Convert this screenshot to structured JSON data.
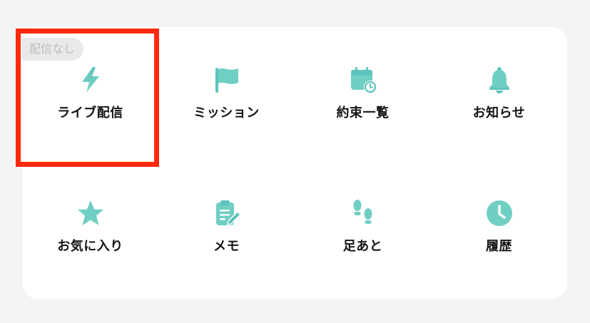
{
  "accent_color": "#6fcfc3",
  "badge": {
    "text": "配信なし"
  },
  "menu": {
    "items": [
      {
        "label": "ライブ配信",
        "icon": "lightning-icon"
      },
      {
        "label": "ミッション",
        "icon": "flag-icon"
      },
      {
        "label": "約束一覧",
        "icon": "calendar-clock-icon"
      },
      {
        "label": "お知らせ",
        "icon": "bell-icon"
      },
      {
        "label": "お気に入り",
        "icon": "star-icon"
      },
      {
        "label": "メモ",
        "icon": "clipboard-pen-icon"
      },
      {
        "label": "足あと",
        "icon": "footprints-icon"
      },
      {
        "label": "履歴",
        "icon": "clock-icon"
      }
    ]
  }
}
